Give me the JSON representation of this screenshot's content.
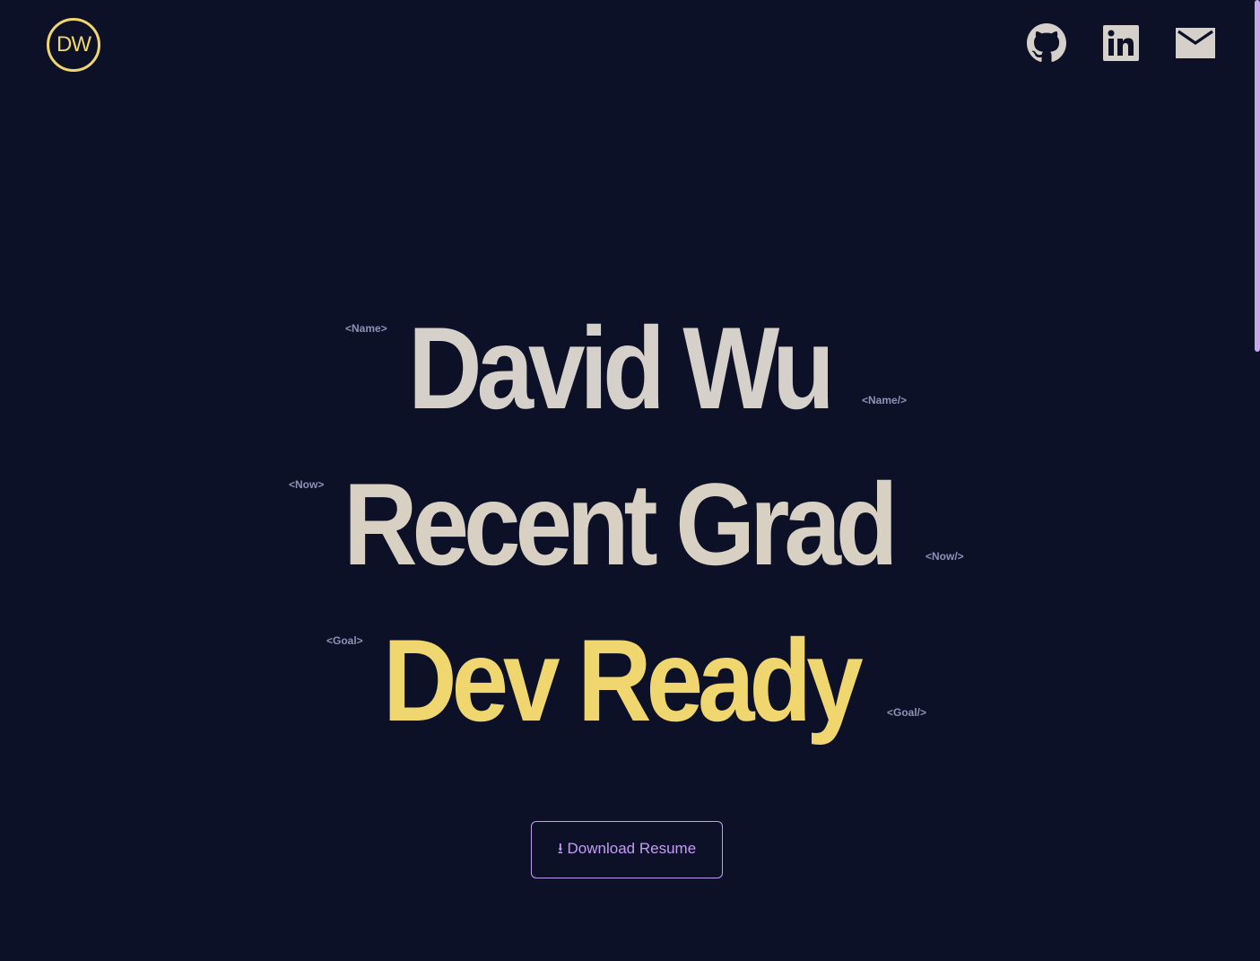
{
  "header": {
    "logo_text": "DW",
    "social": [
      {
        "name": "github-icon",
        "label": "GitHub"
      },
      {
        "name": "linkedin-icon",
        "label": "LinkedIn"
      },
      {
        "name": "mail-icon",
        "label": "Email"
      }
    ]
  },
  "hero": {
    "name": {
      "open_tag": "<Name>",
      "text": "David Wu",
      "close_tag": "<Name/>"
    },
    "now": {
      "open_tag": "<Now>",
      "text": "Recent Grad",
      "close_tag": "<Now/>"
    },
    "goal": {
      "open_tag": "<Goal>",
      "text": "Dev Ready",
      "close_tag": "<Goal/>"
    }
  },
  "cta": {
    "download_resume_label": "⭳ Download Resume"
  },
  "colors": {
    "background": "#0d1128",
    "accent_yellow": "#f0d66e",
    "accent_purple": "#c39ef0",
    "text_light": "#d5d0ca",
    "tag_color": "#8d91b3"
  }
}
